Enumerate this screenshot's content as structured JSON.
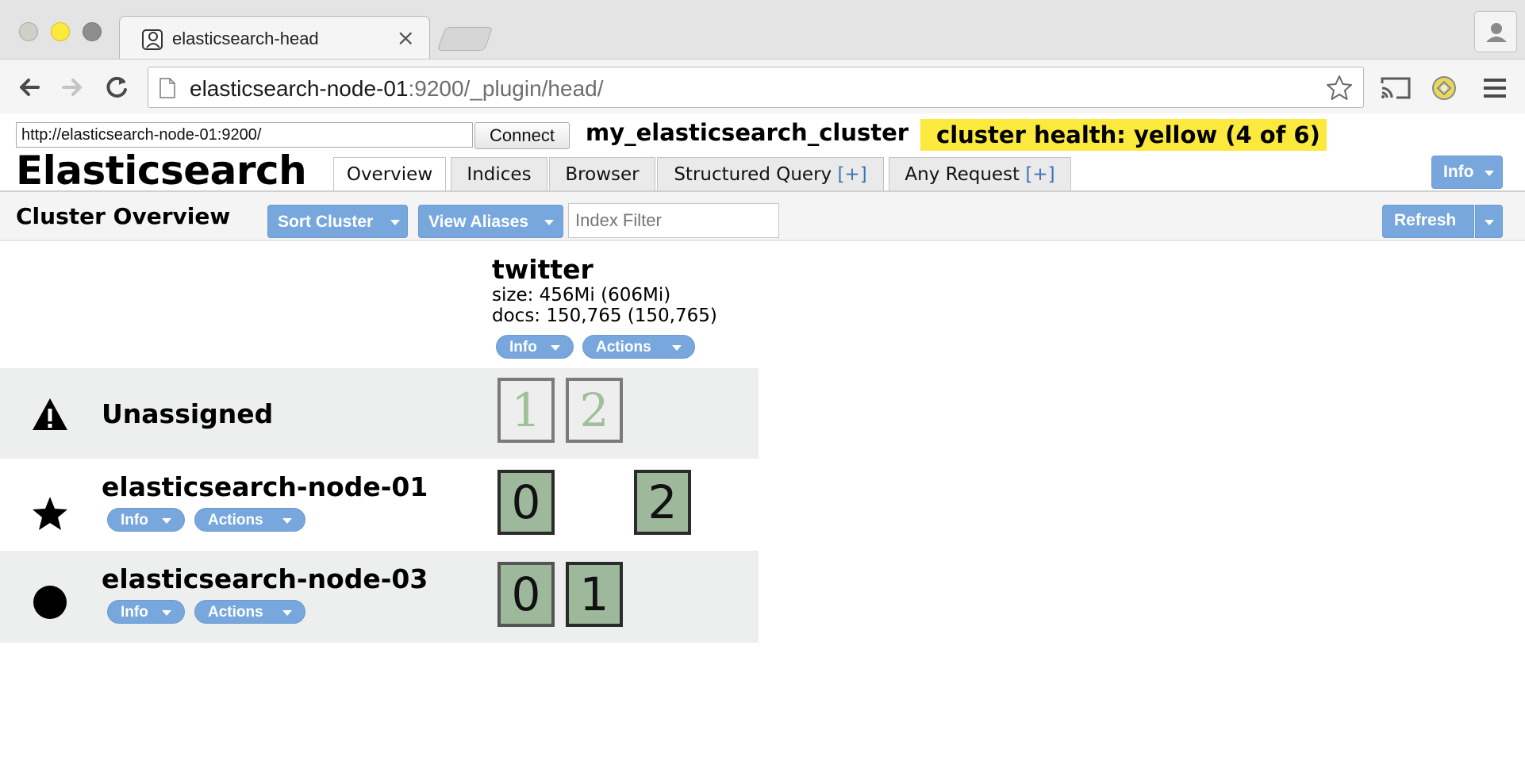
{
  "browser": {
    "tab_title": "elasticsearch-head",
    "tab_close": "×",
    "url_host": "elasticsearch-node-01",
    "url_rest": ":9200/_plugin/head/"
  },
  "header": {
    "connection_url": "http://elasticsearch-node-01:9200/",
    "connect_label": "Connect",
    "cluster_name": "my_elasticsearch_cluster",
    "cluster_health": "cluster health: yellow (4 of 6)",
    "app_title": "Elasticsearch",
    "tabs": [
      {
        "label": "Overview",
        "plus": ""
      },
      {
        "label": "Indices",
        "plus": ""
      },
      {
        "label": "Browser",
        "plus": ""
      },
      {
        "label": "Structured Query ",
        "plus": "[+]"
      },
      {
        "label": "Any Request ",
        "plus": "[+]"
      }
    ],
    "info_label": "Info"
  },
  "subheader": {
    "title": "Cluster Overview",
    "sort_cluster": "Sort Cluster",
    "view_aliases": "View Aliases",
    "index_filter_placeholder": "Index Filter",
    "refresh": "Refresh"
  },
  "index": {
    "name": "twitter",
    "size": "size: 456Mi (606Mi)",
    "docs": "docs: 150,765 (150,765)",
    "info": "Info",
    "actions": "Actions"
  },
  "rows": [
    {
      "label": "Unassigned",
      "icon": "warning-icon",
      "shards": [
        "1",
        "2"
      ]
    },
    {
      "label": "elasticsearch-node-01",
      "icon": "star-icon",
      "info": "Info",
      "actions": "Actions",
      "shards": [
        "0",
        "2"
      ]
    },
    {
      "label": "elasticsearch-node-03",
      "icon": "circle-icon",
      "info": "Info",
      "actions": "Actions",
      "shards": [
        "0",
        "1"
      ]
    }
  ],
  "colors": {
    "health_yellow": "#fbe93e",
    "button_blue": "#77a7dd",
    "shard_green": "#9eb89c"
  }
}
